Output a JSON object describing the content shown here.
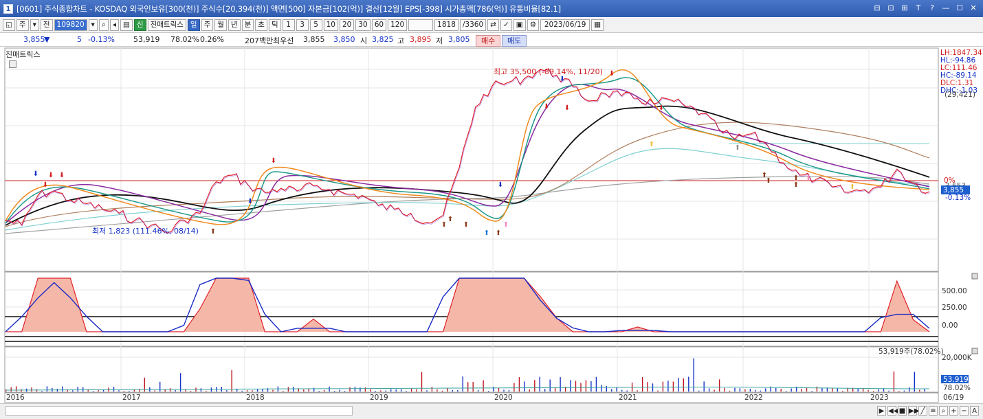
{
  "window": {
    "icon": "1",
    "title": "[0601] 주식종합차트 - KOSDAQ 외국인보유[300(천)] 주식수[20,394(천)] 액면[500] 자본금[102(억)] 결산[12월] EPS[-398] 시가총액[786(억)] 유통비율[82.1]",
    "buttons": [
      "⊟",
      "⊡",
      "⊞",
      "T",
      "?",
      "—",
      "☐",
      "✕"
    ]
  },
  "toolbar": {
    "mode": "주",
    "type": "전",
    "code": "109820",
    "indicator_label": "진매트릭스",
    "period_tabs": [
      "일",
      "주",
      "월",
      "년",
      "분",
      "초",
      "틱"
    ],
    "selected_period": "일",
    "intervals": [
      "1",
      "3",
      "5",
      "10",
      "20",
      "30",
      "60",
      "120"
    ],
    "count": "1818",
    "total": "/3360",
    "date": "2023/06/19"
  },
  "quote": {
    "price": "3,855",
    "change": "5",
    "change_pct": "-0.13%",
    "volume": "53,919",
    "vol_pct": "78.02%",
    "turnover": "0.26%",
    "amount": "207백만",
    "best_label": "최우선",
    "ask": "3,855",
    "bid": "3,850",
    "open_label": "시",
    "open": "3,825",
    "high_label": "고",
    "high": "3,895",
    "low_label": "저",
    "low": "3,805",
    "buy": "매수",
    "sell": "매도"
  },
  "colors": {
    "price": "#e0202a",
    "ma5": "#f08a1c",
    "ma10": "#8a2aa0",
    "ma20": "#1e9a8a",
    "ma60": "#111111",
    "ma120": "#a07050",
    "ma240": "#80d0d0",
    "volume": "#c0141e",
    "osc_fill": "#f5b8a8"
  },
  "chart_data": {
    "type": "line",
    "title": "진매트릭스",
    "x_labels": [
      "2016",
      "2017",
      "2018",
      "2019",
      "2020",
      "2021",
      "2022",
      "2023",
      "06/19"
    ],
    "price_series": [
      2300,
      2100,
      3600,
      3900,
      3300,
      3100,
      2800,
      2600,
      2300,
      2100,
      1823,
      2300,
      2600,
      4600,
      5200,
      4300,
      3800,
      4100,
      3900,
      4300,
      4000,
      3700,
      3600,
      3000,
      2800,
      2600,
      2200,
      2500,
      6000,
      18000,
      26000,
      28000,
      30000,
      35500,
      32000,
      26000,
      20000,
      23000,
      22000,
      21000,
      19000,
      20500,
      18000,
      16000,
      12000,
      10000,
      11000,
      9000,
      6500,
      5200,
      4800,
      4200,
      3800,
      4000,
      4200,
      5800,
      4500,
      3855
    ],
    "annotations": {
      "high": "최고 35,500 (-89.14%, 11/20)",
      "low": "최저 1,823 (111.46%, 08/14)"
    },
    "right_panel": [
      "LH:1847.34",
      "HL:-94.86",
      "LC:111.46",
      "HC:-89.14",
      "DLC:1.31",
      "DHC:-1.03",
      "(29,421)",
      "0%",
      "3,855",
      "-0.13%",
      "3,653"
    ],
    "price_label": "3,855",
    "zero_label": "0%",
    "osc_axis": [
      "500.00",
      "250.00",
      "0.00"
    ],
    "vol_axis": [
      "20,000K",
      "53,919",
      "78.02%"
    ],
    "vol_head": "53,919주(78.02%)"
  }
}
